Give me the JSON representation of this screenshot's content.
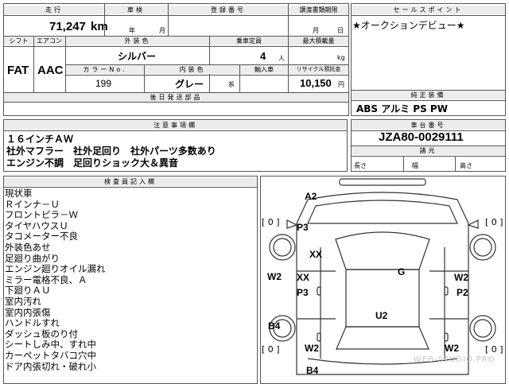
{
  "header": {
    "mileage_label": "走行",
    "inspection_label": "車検",
    "registration_label": "登録番号",
    "transfer_deadline_label": "譲渡書類期限",
    "sales_point_label": "セールスポイント"
  },
  "mileage": {
    "value": "71,247",
    "unit": "km"
  },
  "inspection": {
    "year_unit": "年",
    "month_unit": "月"
  },
  "transfer": {
    "month_unit": "月",
    "day_unit": "日"
  },
  "sales_point": {
    "text": "★オークションデビュー★"
  },
  "spec": {
    "shift_label": "シフト",
    "aircon_label": "エアコン",
    "exterior_color_label": "外装色",
    "capacity_label": "乗車定員",
    "max_load_label": "最大積載量",
    "shift_value": "FAT",
    "aircon_value": "AAC",
    "exterior_color_value": "シルバー",
    "capacity_value": "4",
    "capacity_unit": "人",
    "max_load_unit": "kg",
    "color_no_label": "カラーNo.",
    "interior_color_label": "内装色",
    "import_label": "輸入車",
    "recycle_label": "リサイクル預託金",
    "color_no_value": "199",
    "interior_color_value": "グレー",
    "interior_color_suffix": "系",
    "recycle_value": "10,150",
    "recycle_unit": "円"
  },
  "later_items_label": "後日発送部品",
  "equipment": {
    "label": "純正装備",
    "value": "ABS アルミ PS PW"
  },
  "notes": {
    "label": "注意事項欄",
    "lines": [
      "１６インチＡＷ",
      "社外マフラー　社外足回り　社外パーツ多数あり",
      "エンジン不調　足回りショック大＆異音"
    ]
  },
  "chassis": {
    "label": "車台番号",
    "value": "JZA80-0029111",
    "dimensions_label": "諸元",
    "length_label": "長さ",
    "width_label": "幅",
    "height_label": "高さ"
  },
  "inspector": {
    "label": "検査員記入欄",
    "remarks": [
      "現状車",
      "Ｒインナ－Ｕ",
      "フロントピラ－Ｗ",
      "タイヤハウスＵ",
      "タコメーター不良",
      "外装色あせ",
      "足廻り曲がり",
      "エンジン廻りオイル漏れ",
      "ミラー電格不良、Ａ",
      "下廻りＡＵ",
      "室内汚れ",
      "室内内張傷",
      "ハンドルすれ",
      "ダッシュ板のり付",
      "シートしみ中、すれ中",
      "カーペットタバコ穴中",
      "ドア内張切れ・破れ小"
    ]
  },
  "diagram": {
    "marks": {
      "a2_top": "A2",
      "p3_upper": "P3",
      "xx_upper": "XX",
      "g": "G",
      "w2_left": "W2",
      "xx_lower": "XX",
      "p3_lower": "P3",
      "w2_right_upper": "W2",
      "p2": "P2",
      "u2": "U2",
      "b4_left": "B4",
      "w2_bottom_left": "W2",
      "w2_bottom_right": "W2",
      "b4_bottom": "B4"
    },
    "tire_left": "[ 0 ]",
    "tire_right": "[ 0 ]",
    "tire_bottom_left": "[ 0 ]",
    "tire_bottom_right": "[ 0 ]"
  },
  "watermark": "WEB-STUDIO.PRO"
}
